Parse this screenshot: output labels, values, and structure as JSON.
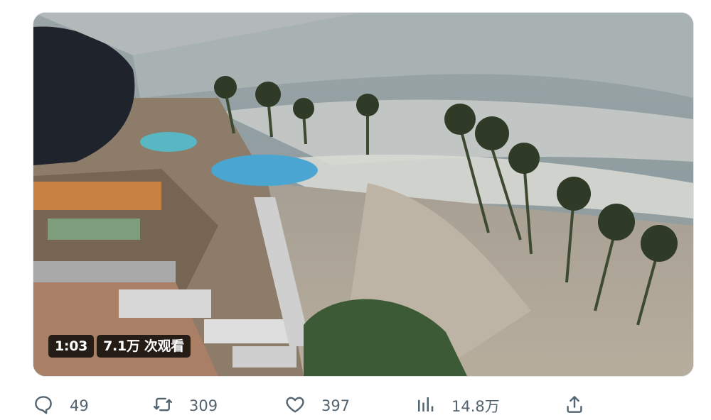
{
  "video": {
    "duration": "1:03",
    "views": "7.1万 次观看"
  },
  "actions": {
    "replies": {
      "icon": "reply-icon",
      "count": "49"
    },
    "retweets": {
      "icon": "retweet-icon",
      "count": "309"
    },
    "likes": {
      "icon": "heart-icon",
      "count": "397"
    },
    "views": {
      "icon": "analytics-icon",
      "count": "14.8万"
    },
    "share": {
      "icon": "share-icon"
    }
  },
  "colors": {
    "icon": "#536471",
    "text": "#536471",
    "badge_bg": "#000000"
  }
}
